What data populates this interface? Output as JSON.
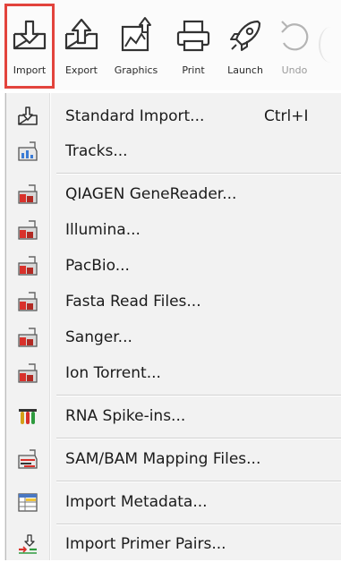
{
  "toolbar": {
    "buttons": [
      {
        "label": "Import",
        "icon": "import-icon",
        "selected": true
      },
      {
        "label": "Export",
        "icon": "export-icon"
      },
      {
        "label": "Graphics",
        "icon": "graphics-icon"
      },
      {
        "label": "Print",
        "icon": "print-icon"
      },
      {
        "label": "Launch",
        "icon": "rocket-icon"
      },
      {
        "label": "Undo",
        "icon": "undo-icon",
        "disabled": true
      }
    ],
    "highlight_color": "#e2433c"
  },
  "menu": {
    "items": [
      {
        "label": "Standard Import...",
        "shortcut": "Ctrl+I",
        "icon": "import-icon"
      },
      {
        "label": "Tracks...",
        "icon": "tracks-import-icon"
      },
      {
        "label": "QIAGEN GeneReader...",
        "icon": "folder-import-icon"
      },
      {
        "label": "Illumina...",
        "icon": "folder-import-icon"
      },
      {
        "label": "PacBio...",
        "icon": "folder-import-icon"
      },
      {
        "label": "Fasta Read Files...",
        "icon": "folder-import-icon"
      },
      {
        "label": "Sanger...",
        "icon": "folder-import-icon"
      },
      {
        "label": "Ion Torrent...",
        "icon": "folder-import-icon"
      },
      {
        "label": "RNA Spike-ins...",
        "icon": "test-tubes-icon"
      },
      {
        "label": "SAM/BAM Mapping Files...",
        "icon": "mapping-import-icon"
      },
      {
        "label": "Import Metadata...",
        "icon": "metadata-table-icon"
      },
      {
        "label": "Import Primer Pairs...",
        "icon": "primer-pairs-icon"
      }
    ]
  }
}
